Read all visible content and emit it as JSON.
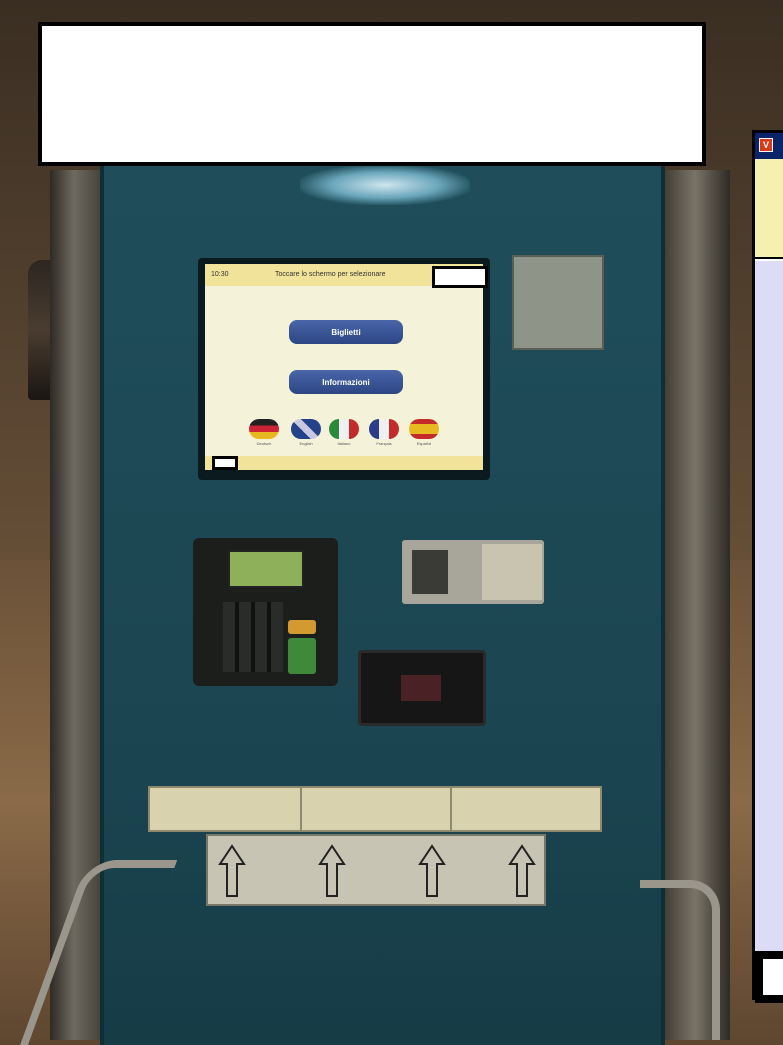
{
  "kiosk": {
    "screen": {
      "time": "10:30",
      "header": "Toccare lo schermo per selezionare",
      "buttons": {
        "tickets": "Biglietti",
        "info": "Informazioni"
      },
      "languages": [
        "Deutsch",
        "English",
        "Italiano",
        "Français",
        "Español"
      ]
    }
  },
  "window_icon": {
    "letter": "V"
  }
}
